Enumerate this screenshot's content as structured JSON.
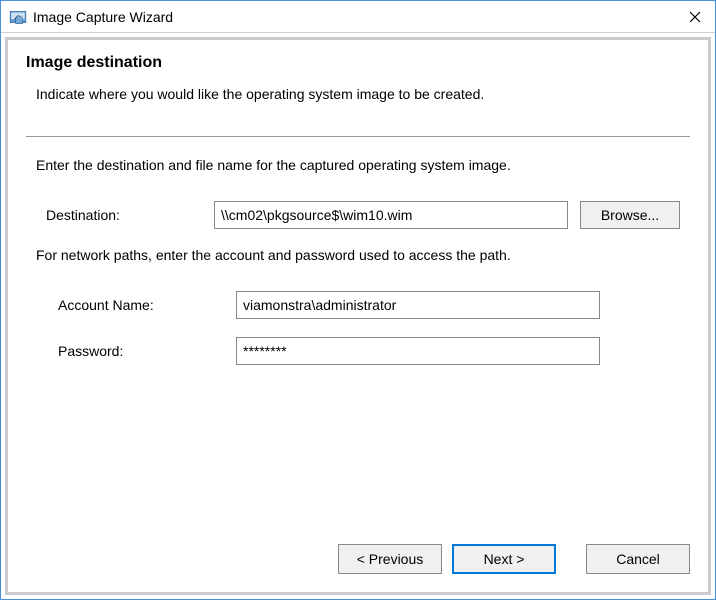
{
  "window": {
    "title": "Image Capture Wizard"
  },
  "header": {
    "heading": "Image destination",
    "subheading": "Indicate where you would like the operating system image to be created."
  },
  "form": {
    "instruction1": "Enter the destination and file name for the captured operating system image.",
    "destination_label": "Destination:",
    "destination_value": "\\\\cm02\\pkgsource$\\wim10.wim",
    "browse_label": "Browse...",
    "instruction2": "For network paths, enter the account and password used to access the path.",
    "account_label": "Account Name:",
    "account_value": "viamonstra\\administrator",
    "password_label": "Password:",
    "password_value": "********"
  },
  "buttons": {
    "previous": "< Previous",
    "next": "Next >",
    "cancel": "Cancel"
  }
}
